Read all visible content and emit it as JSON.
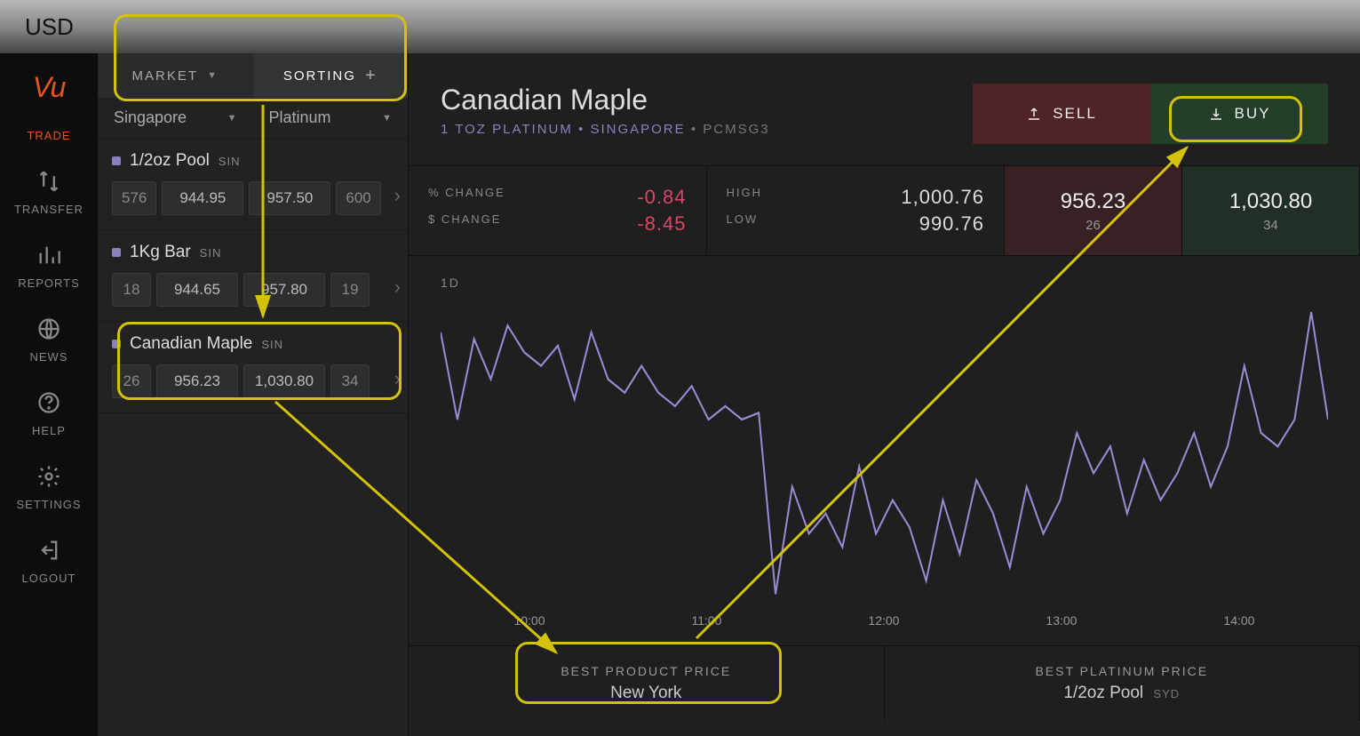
{
  "currency": "USD",
  "sidebar": {
    "logo": "Vu",
    "items": [
      {
        "label": "TRADE"
      },
      {
        "label": "TRANSFER"
      },
      {
        "label": "REPORTS"
      },
      {
        "label": "NEWS"
      },
      {
        "label": "HELP"
      },
      {
        "label": "SETTINGS"
      },
      {
        "label": "LOGOUT"
      }
    ]
  },
  "tabs": {
    "market": "MARKET",
    "sorting": "SORTING"
  },
  "filters": {
    "location": "Singapore",
    "metal": "Platinum"
  },
  "products": [
    {
      "name": "1/2oz Pool",
      "loc": "SIN",
      "sellQty": "576",
      "sell": "944.95",
      "buy": "957.50",
      "buyQty": "600"
    },
    {
      "name": "1Kg Bar",
      "loc": "SIN",
      "sellQty": "18",
      "sell": "944.65",
      "buy": "957.80",
      "buyQty": "19"
    },
    {
      "name": "Canadian Maple",
      "loc": "SIN",
      "sellQty": "26",
      "sell": "956.23",
      "buy": "1,030.80",
      "buyQty": "34"
    }
  ],
  "detail": {
    "title": "Canadian Maple",
    "subWeight": "1 TOZ PLATINUM",
    "subLoc": "SINGAPORE",
    "subCode": "PCMSG3",
    "sellLabel": "SELL",
    "buyLabel": "BUY",
    "pctChangeLabel": "% CHANGE",
    "pctChange": "-0.84",
    "dolChangeLabel": "$ CHANGE",
    "dolChange": "-8.45",
    "highLabel": "HIGH",
    "high": "1,000.76",
    "lowLabel": "LOW",
    "low": "990.76",
    "sellPrice": "956.23",
    "sellQty": "26",
    "buyPrice": "1,030.80",
    "buyQty": "34",
    "timeframe": "1D"
  },
  "footer": {
    "bestProductLabel": "BEST PRODUCT PRICE",
    "bestProductLoc": "New York",
    "bestMetalLabel": "BEST PLATINUM PRICE",
    "bestMetalName": "1/2oz Pool",
    "bestMetalLoc": "SYD"
  },
  "chart_data": {
    "type": "line",
    "xlabel": "",
    "ylabel": "",
    "x_ticks": [
      "10:00",
      "11:00",
      "12:00",
      "13:00",
      "14:00"
    ],
    "ylim": [
      955,
      1000
    ],
    "series": [
      {
        "name": "price",
        "color": "#9b8bd4",
        "values": [
          995,
          982,
          994,
          988,
          996,
          992,
          990,
          993,
          985,
          995,
          988,
          986,
          990,
          986,
          984,
          987,
          982,
          984,
          982,
          983,
          956,
          972,
          965,
          968,
          963,
          975,
          965,
          970,
          966,
          958,
          970,
          962,
          973,
          968,
          960,
          972,
          965,
          970,
          980,
          974,
          978,
          968,
          976,
          970,
          974,
          980,
          972,
          978,
          990,
          980,
          978,
          982,
          998,
          982
        ]
      }
    ]
  }
}
